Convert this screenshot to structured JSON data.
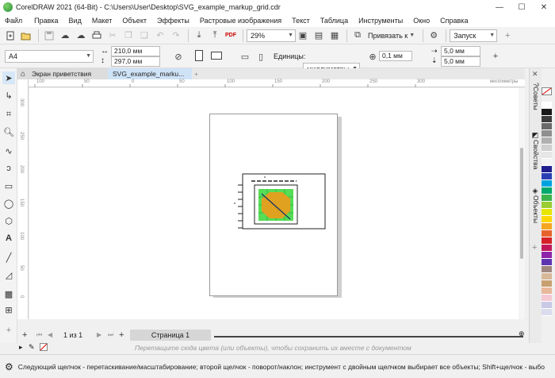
{
  "window": {
    "title": "CorelDRAW 2021 (64-Bit) - C:\\Users\\User\\Desktop\\SVG_example_markup_grid.cdr",
    "minimize_glyph": "—",
    "maximize_glyph": "☐",
    "close_glyph": "✕"
  },
  "menu": [
    "Файл",
    "Правка",
    "Вид",
    "Макет",
    "Объект",
    "Эффекты",
    "Растровые изображения",
    "Текст",
    "Таблица",
    "Инструменты",
    "Окно",
    "Справка"
  ],
  "toolbar": {
    "zoom_value": "29%",
    "snap_label": "Привязать к",
    "launch_label": "Запуск"
  },
  "properties": {
    "page_size": "A4",
    "width": "210,0 мм",
    "height": "297,0 мм",
    "units_label": "Единицы:",
    "units_value": "миллиметры",
    "nudge": "0,1 мм",
    "dup_x": "5,0 мм",
    "dup_y": "5,0 мм"
  },
  "tabs": {
    "welcome": "Экран приветствия",
    "document": "SVG_example_marku...",
    "add": "+"
  },
  "ruler": {
    "unit": "миллиметры",
    "top_ticks": [
      "100",
      "50",
      "0",
      "50",
      "100",
      "150",
      "200",
      "250",
      "300"
    ],
    "left_ticks": [
      "300",
      "250",
      "200",
      "150",
      "100",
      "50",
      "0"
    ]
  },
  "dockers": [
    "Советы",
    "Свойства",
    "Объекты"
  ],
  "palette": [
    "#ffffff",
    "#1a1a1a",
    "#3d3d3d",
    "#6a6a6a",
    "#8f8f8f",
    "#b0b0b0",
    "#cfcfcf",
    "#e6e6e6",
    "#f3f3f3",
    "#1f1f8f",
    "#2b3fb5",
    "#00a3e0",
    "#00a86b",
    "#3cb44b",
    "#9acd32",
    "#e6e600",
    "#ffd700",
    "#f5a623",
    "#e8632c",
    "#d62027",
    "#c2185b",
    "#8e24aa",
    "#5e35b1",
    "#a1887f",
    "#d7b899",
    "#c8a070",
    "#e8b89a",
    "#f4c9d4",
    "#c9c9e6",
    "#dcdcf0"
  ],
  "pagenav": {
    "counter": "1 из 1",
    "page_tab": "Страница 1"
  },
  "colorhint": "Перетащите сюда цвета (или объекты), чтобы сохранить их вместе с документом",
  "status": "Следующий щелчок - перетаскивание/масштабирование; второй щелчок - поворот/наклон; инструмент с двойным щелчком выбирает все объекты; Shift+щелчок - выбо",
  "drawing": {
    "accent_green": "#55dd55",
    "accent_orange": "#e0a020",
    "diagonal_color": "#1e3a5f"
  }
}
